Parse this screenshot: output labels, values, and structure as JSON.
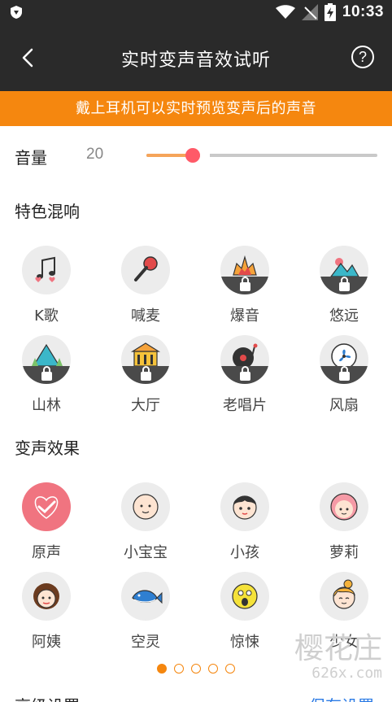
{
  "status_bar": {
    "time": "10:33",
    "icons": [
      "shield-icon",
      "wifi-icon",
      "no-signal-icon",
      "battery-charging-icon"
    ]
  },
  "header": {
    "title": "实时变声音效试听",
    "back_icon": "chevron-left-icon",
    "help_label": "?"
  },
  "banner": {
    "text": "戴上耳机可以实时预览变声后的声音"
  },
  "volume": {
    "label": "音量",
    "value": "20",
    "level": 0.2
  },
  "section_mix": {
    "title": "特色混响",
    "items": [
      {
        "label": "K歌",
        "icon": "music-note-hearts-icon",
        "locked": false
      },
      {
        "label": "喊麦",
        "icon": "microphone-icon",
        "locked": false
      },
      {
        "label": "爆音",
        "icon": "explosion-icon",
        "locked": true
      },
      {
        "label": "悠远",
        "icon": "mountain-sun-icon",
        "locked": true
      },
      {
        "label": "山林",
        "icon": "forest-mountain-icon",
        "locked": true
      },
      {
        "label": "大厅",
        "icon": "hall-building-icon",
        "locked": true
      },
      {
        "label": "老唱片",
        "icon": "record-player-icon",
        "locked": true
      },
      {
        "label": "风扇",
        "icon": "fan-icon",
        "locked": true
      }
    ]
  },
  "section_voice": {
    "title": "变声效果",
    "items": [
      {
        "label": "原声",
        "icon": "heart-check-icon",
        "selected": true
      },
      {
        "label": "小宝宝",
        "icon": "baby-face-icon"
      },
      {
        "label": "小孩",
        "icon": "child-face-icon"
      },
      {
        "label": "萝莉",
        "icon": "girl-face-icon"
      },
      {
        "label": "阿姨",
        "icon": "aunt-face-icon"
      },
      {
        "label": "空灵",
        "icon": "whale-icon"
      },
      {
        "label": "惊悚",
        "icon": "scared-face-icon"
      },
      {
        "label": "少女",
        "icon": "young-woman-icon"
      }
    ]
  },
  "pager": {
    "count": 5,
    "active": 0
  },
  "footer": {
    "left": "高级设置",
    "right": "保存设置"
  },
  "watermark": {
    "main": "樱花庄",
    "sub": "626x.com"
  },
  "colors": {
    "accent": "#f5870f",
    "dark": "#2a2a2a",
    "thumb": "#ff5a68",
    "selected": "#f07480",
    "link": "#2c7be5"
  }
}
